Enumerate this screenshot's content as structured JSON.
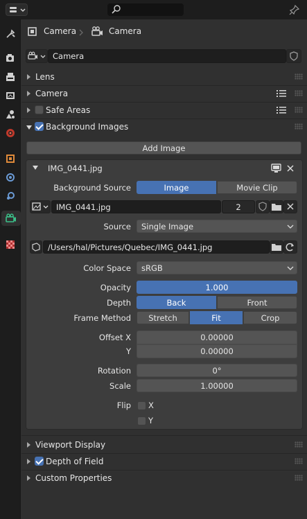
{
  "header": {
    "breadcrumb_object": "Camera",
    "breadcrumb_data": "Camera"
  },
  "datablock": {
    "name": "Camera"
  },
  "panels": {
    "lens": "Lens",
    "camera": "Camera",
    "safe_areas": "Safe Areas",
    "background_images": "Background Images",
    "viewport_display": "Viewport Display",
    "depth_of_field": "Depth of Field",
    "custom_properties": "Custom Properties"
  },
  "checks": {
    "safe_areas": false,
    "background_images": true,
    "depth_of_field": true,
    "flip_x": false,
    "flip_y": false
  },
  "bg": {
    "add_image": "Add Image",
    "image_name": "IMG_0441.jpg",
    "source_label": "Background Source",
    "source_options": [
      "Image",
      "Movie Clip"
    ],
    "source_selected": "Image",
    "image_datablock": "IMG_0441.jpg",
    "users": "2",
    "src_label": "Source",
    "src_value": "Single Image",
    "filepath": "/Users/hal/Pictures/Quebec/IMG_0441.jpg",
    "colorspace_label": "Color Space",
    "colorspace_value": "sRGB",
    "opacity_label": "Opacity",
    "opacity_value": "1.000",
    "depth_label": "Depth",
    "depth_options": [
      "Back",
      "Front"
    ],
    "depth_selected": "Back",
    "frame_label": "Frame Method",
    "frame_options": [
      "Stretch",
      "Fit",
      "Crop"
    ],
    "frame_selected": "Fit",
    "offsetx_label": "Offset X",
    "offsetx_value": "0.00000",
    "offsety_label": "Y",
    "offsety_value": "0.00000",
    "rotation_label": "Rotation",
    "rotation_value": "0°",
    "scale_label": "Scale",
    "scale_value": "1.00000",
    "flip_label": "Flip",
    "flip_x": "X",
    "flip_y": "Y"
  },
  "colors": {
    "accent": "#4772b3",
    "panel_bg": "#303030",
    "field_bg": "#545454",
    "dark_field": "#1e1e1e"
  },
  "icons": {
    "tabs": [
      "tool-icon",
      "render-icon",
      "output-icon",
      "view-layer-icon",
      "scene-icon",
      "world-icon",
      "object-icon",
      "modifier-icon",
      "physics-icon",
      "camera-data-icon",
      "texture-icon"
    ]
  }
}
